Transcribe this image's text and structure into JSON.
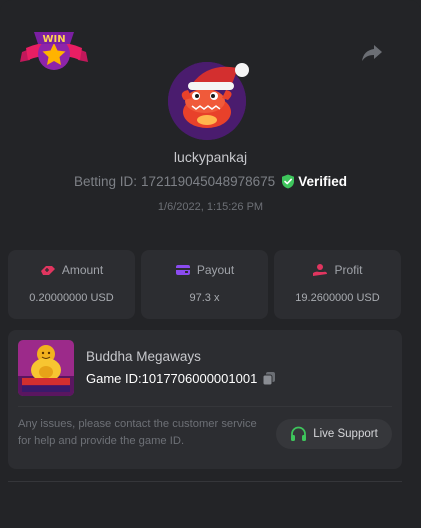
{
  "header": {
    "badge_icon": "win-star-badge-icon",
    "share_icon": "share-arrow-icon"
  },
  "profile": {
    "avatar_icon": "red-dragon-santa-hat-avatar",
    "username": "luckypankaj",
    "betting_id_label": "Betting ID:",
    "betting_id_value": "172119045048978675",
    "verified_label": "Verified",
    "timestamp": "1/6/2022, 1:15:26 PM"
  },
  "stats": [
    {
      "label": "Amount",
      "value": "0.20000000 USD",
      "icon": "amount-coin-icon"
    },
    {
      "label": "Payout",
      "value": "97.3 x",
      "icon": "payout-wallet-icon"
    },
    {
      "label": "Profit",
      "value": "19.2600000 USD",
      "icon": "profit-hand-icon"
    }
  ],
  "game": {
    "name": "Buddha Megaways",
    "id_label": "Game ID:",
    "id_value": "1017706000001001",
    "issues_text": "Any issues, please contact the customer service for help and provide the game ID.",
    "support_label": "Live Support"
  },
  "colors": {
    "background": "#232427",
    "card": "#2c2d31",
    "verified_green": "#3ec55c",
    "accent_pink": "#e0355f",
    "accent_purple": "#8b4bf0"
  }
}
